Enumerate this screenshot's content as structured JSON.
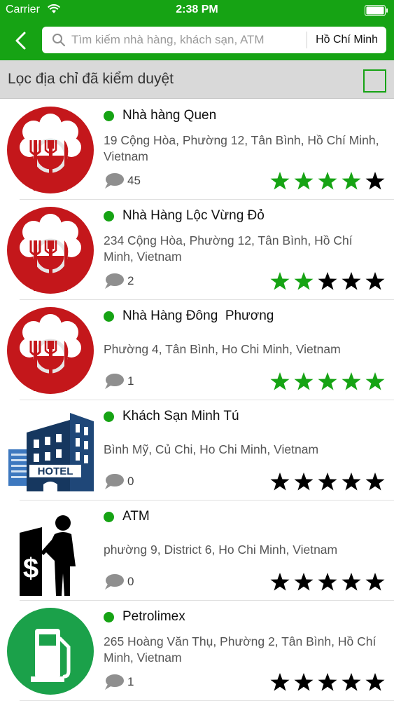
{
  "status_bar": {
    "carrier": "Carrier",
    "time": "2:38 PM"
  },
  "nav": {
    "search_placeholder": "Tìm kiếm nhà hàng, khách sạn, ATM",
    "city": "Hồ Chí Minh"
  },
  "filter": {
    "label": "Lọc địa chỉ đã kiểm duyệt",
    "checked": false
  },
  "colors": {
    "brand_green": "#16a314",
    "star_filled": "#16a314",
    "star_empty": "#000000"
  },
  "places": [
    {
      "name": "Nhà hàng Quen",
      "address": "19 Cộng Hòa, Phường 12, Tân Bình, Hồ Chí Minh, Vietnam",
      "comments": "45",
      "rating": 4,
      "icon": "restaurant-icon"
    },
    {
      "name": "Nhà Hàng Lộc Vừng Đỏ",
      "address": "234 Cộng Hòa, Phường 12, Tân Bình, Hồ Chí Minh, Vietnam",
      "comments": "2",
      "rating": 2,
      "icon": "restaurant-icon"
    },
    {
      "name": "Nhà Hàng Đông  Phương",
      "address": "Phường 4, Tân Bình, Ho Chi Minh, Vietnam",
      "comments": "1",
      "rating": 5,
      "icon": "restaurant-icon"
    },
    {
      "name": "Khách Sạn Minh Tú",
      "address": "Bình Mỹ, Củ Chi, Ho Chi Minh, Vietnam",
      "comments": "0",
      "rating": 0,
      "icon": "hotel-icon",
      "icon_label": "HOTEL"
    },
    {
      "name": "ATM",
      "address": "phường 9, District 6, Ho Chi Minh, Vietnam",
      "comments": "0",
      "rating": 0,
      "icon": "atm-icon"
    },
    {
      "name": "Petrolimex",
      "address": "265 Hoàng Văn Thụ, Phường 2, Tân Bình, Hồ Chí Minh, Vietnam",
      "comments": "1",
      "rating": 0,
      "icon": "gas-station-icon"
    }
  ]
}
